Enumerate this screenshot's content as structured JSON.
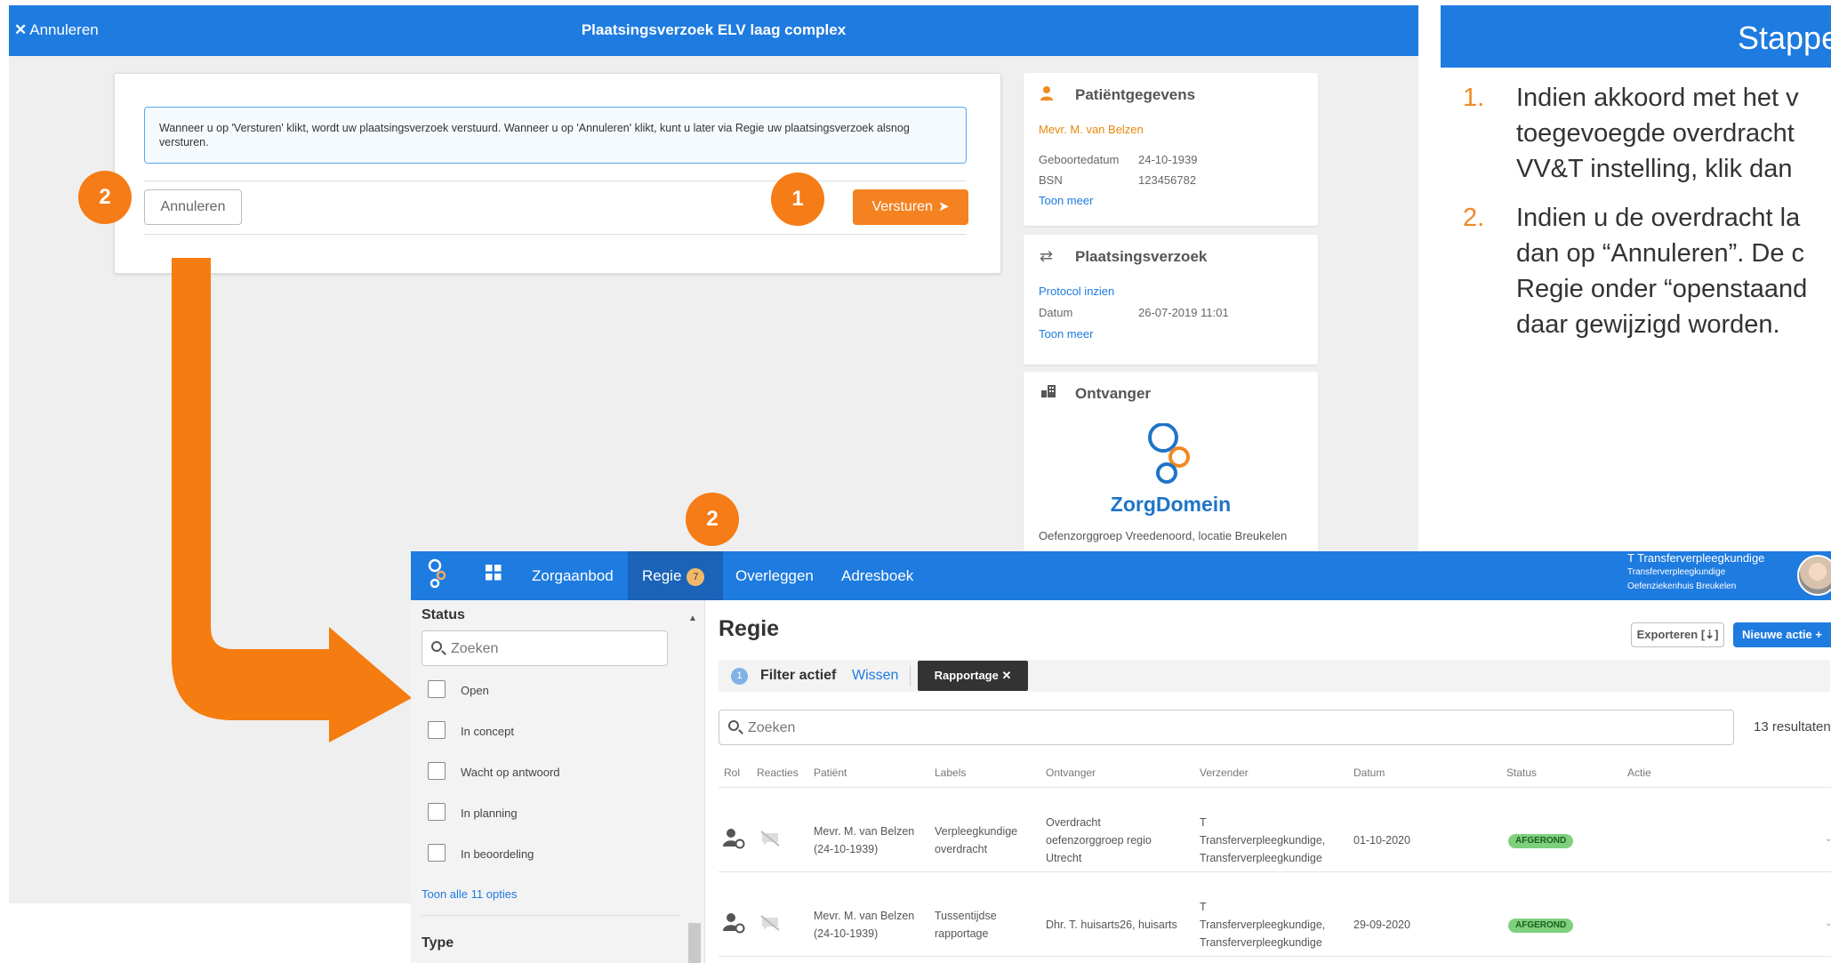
{
  "modal": {
    "cancel_label": "Annuleren",
    "title": "Plaatsingsverzoek ELV laag complex",
    "info_text": "Wanneer u op 'Versturen' klikt, wordt uw plaatsingsverzoek verstuurd. Wanneer u op 'Annuleren' klikt, kunt u later via Regie uw plaatsingsverzoek alsnog versturen.",
    "btn_cancel": "Annuleren",
    "btn_send": "Versturen"
  },
  "markers": {
    "one": "1",
    "two": "2",
    "three": "2"
  },
  "patient_card": {
    "title": "Patiëntgegevens",
    "name": "Mevr. M. van Belzen",
    "dob_label": "Geboortedatum",
    "dob_value": "24-10-1939",
    "bsn_label": "BSN",
    "bsn_value": "123456782",
    "more": "Toon meer"
  },
  "request_card": {
    "title": "Plaatsingsverzoek",
    "protocol": "Protocol inzien",
    "date_label": "Datum",
    "date_value": "26-07-2019 11:01",
    "more": "Toon meer"
  },
  "receiver_card": {
    "title": "Ontvanger",
    "logo_text": "ZorgDomein",
    "org": "Oefenzorggroep Vreedenoord, locatie Breukelen"
  },
  "instructions": {
    "title": "Stappe",
    "items": [
      {
        "num": "1.",
        "lines": [
          "Indien akkoord met het v",
          "toegevoegde overdracht",
          "VV&T instelling, klik dan"
        ]
      },
      {
        "num": "2.",
        "lines": [
          "Indien u de overdracht la",
          "dan op “Annuleren”. De c",
          "Regie onder “openstaand",
          "daar gewijzigd worden."
        ]
      }
    ]
  },
  "nav": {
    "items": [
      "Zorgaanbod",
      "Regie",
      "Overleggen",
      "Adresboek"
    ],
    "regie_badge": "7",
    "user_name": "T Transferverpleegkundige",
    "user_role": "Transferverpleegkundige",
    "user_org": "Oefenziekenhuis Breukelen"
  },
  "filters": {
    "status_label": "Status",
    "search_placeholder": "Zoeken",
    "options": [
      "Open",
      "In concept",
      "Wacht op antwoord",
      "In planning",
      "In beoordeling"
    ],
    "more": "Toon alle 11 opties",
    "type_label": "Type"
  },
  "main": {
    "title": "Regie",
    "export": "Exporteren",
    "new_action": "Nieuwe actie",
    "filter_count": "1",
    "filter_active": "Filter actief",
    "clear": "Wissen",
    "chip": "Rapportage",
    "search_placeholder": "Zoeken",
    "result_count": "13 resultaten"
  },
  "table": {
    "headers": [
      "Rol",
      "Reacties",
      "Patiënt",
      "Labels",
      "Ontvanger",
      "Verzender",
      "Datum",
      "Status",
      "Actie"
    ],
    "rows": [
      {
        "patient": [
          "Mevr. M. van Belzen",
          "(24-10-1939)"
        ],
        "labels": [
          "Verpleegkundige",
          "overdracht"
        ],
        "receiver": [
          "Overdracht",
          "oefenzorggroep regio",
          "Utrecht"
        ],
        "sender": [
          "T",
          "Transferverpleegkundige,",
          "Transferverpleegkundige"
        ],
        "date": "01-10-2020",
        "status": "AFGEROND"
      },
      {
        "patient": [
          "Mevr. M. van Belzen",
          "(24-10-1939)"
        ],
        "labels": [
          "Tussentijdse",
          "rapportage"
        ],
        "receiver": [
          "Dhr. T. huisarts26, huisarts"
        ],
        "sender": [
          "T",
          "Transferverpleegkundige,",
          "Transferverpleegkundige"
        ],
        "date": "29-09-2020",
        "status": "AFGEROND"
      }
    ]
  },
  "colors": {
    "brand_blue": "#1e7be0",
    "accent_orange": "#f58220",
    "status_green": "#7ed07e"
  }
}
